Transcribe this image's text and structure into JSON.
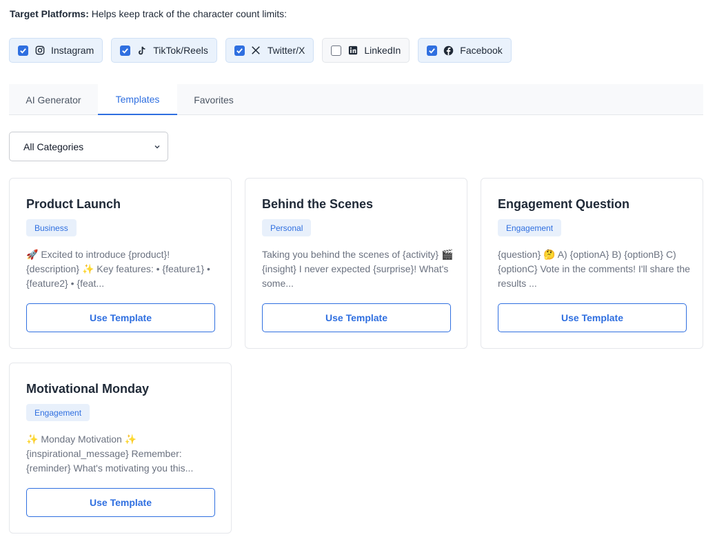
{
  "intro": {
    "label": "Target Platforms:",
    "text": " Helps keep track of the character count limits:"
  },
  "platforms": [
    {
      "label": "Instagram",
      "checked": true,
      "icon": "instagram-icon"
    },
    {
      "label": "TikTok/Reels",
      "checked": true,
      "icon": "tiktok-icon"
    },
    {
      "label": "Twitter/X",
      "checked": true,
      "icon": "x-icon"
    },
    {
      "label": "LinkedIn",
      "checked": false,
      "icon": "linkedin-icon"
    },
    {
      "label": "Facebook",
      "checked": true,
      "icon": "facebook-icon"
    }
  ],
  "tabs": [
    {
      "label": "AI Generator",
      "active": false
    },
    {
      "label": "Templates",
      "active": true
    },
    {
      "label": "Favorites",
      "active": false
    }
  ],
  "category_select": {
    "value": "All Categories",
    "icon": "chevron-down-icon"
  },
  "templates": [
    {
      "title": "Product Launch",
      "category": "Business",
      "preview": "🚀 Excited to introduce {product}! {description} ✨ Key features: • {feature1} • {feature2} • {feat...",
      "button": "Use Template"
    },
    {
      "title": "Behind the Scenes",
      "category": "Personal",
      "preview": "Taking you behind the scenes of {activity} 🎬 {insight} I never expected {surprise}! What's some...",
      "button": "Use Template"
    },
    {
      "title": "Engagement Question",
      "category": "Engagement",
      "preview": "{question} 🤔 A) {optionA} B) {optionB} C) {optionC} Vote in the comments! I'll share the results ...",
      "button": "Use Template"
    },
    {
      "title": "Motivational Monday",
      "category": "Engagement",
      "preview": "✨ Monday Motivation ✨ {inspirational_message} Remember: {reminder} What's motivating you this...",
      "button": "Use Template"
    }
  ],
  "colors": {
    "accent": "#2f6fe0",
    "checked_bg": "#eaf2fc",
    "badge_bg": "#e8f0fb",
    "muted_text": "#6b7280"
  }
}
